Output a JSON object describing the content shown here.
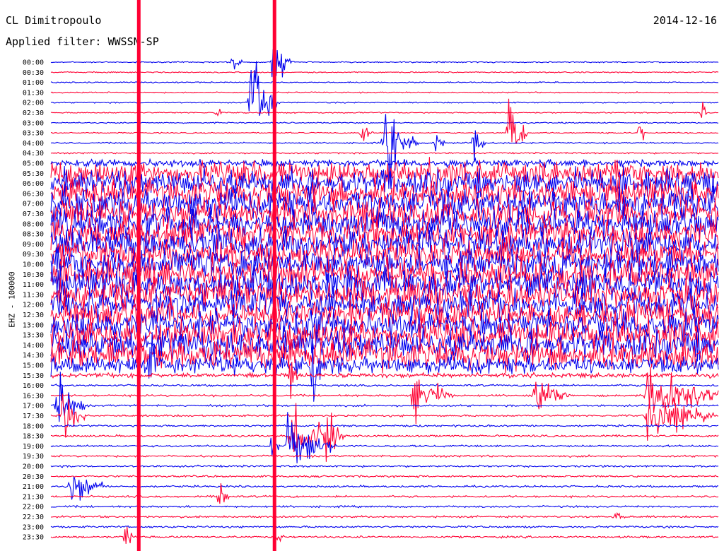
{
  "header": {
    "station": "CL Dimitropoulo",
    "date": "2014-12-16",
    "filter": "Applied filter: WWSSN-SP"
  },
  "colors": {
    "blue": "#0000ee",
    "red": "#ff0033"
  },
  "chart_data": {
    "type": "line",
    "title": "CL Dimitropoulo",
    "ylabel": "EHZ - 100000",
    "y_ticks": [
      "00:00",
      "00:30",
      "01:00",
      "01:30",
      "02:00",
      "02:30",
      "03:00",
      "03:30",
      "04:00",
      "04:30",
      "05:00",
      "05:30",
      "06:00",
      "06:30",
      "07:00",
      "07:30",
      "08:00",
      "08:30",
      "09:00",
      "09:30",
      "10:00",
      "10:30",
      "11:00",
      "11:30",
      "12:00",
      "12:30",
      "13:00",
      "13:30",
      "14:00",
      "14:30",
      "15:00",
      "15:30",
      "16:00",
      "16:30",
      "17:00",
      "17:30",
      "18:00",
      "18:30",
      "19:00",
      "19:30",
      "20:00",
      "20:30",
      "21:00",
      "21:30",
      "22:00",
      "22:30",
      "23:00",
      "23:30"
    ],
    "trace_colors": "alternating blue / red per 30-minute line",
    "noise_level": [
      0.05,
      0.05,
      0.05,
      0.05,
      0.05,
      0.05,
      0.05,
      0.05,
      0.06,
      0.06,
      0.25,
      0.8,
      0.9,
      0.95,
      1.0,
      1.0,
      1.0,
      1.0,
      1.0,
      1.0,
      1.0,
      1.0,
      1.0,
      1.0,
      1.0,
      1.0,
      1.0,
      1.0,
      1.0,
      1.0,
      0.6,
      0.15,
      0.08,
      0.08,
      0.08,
      0.08,
      0.08,
      0.08,
      0.08,
      0.08,
      0.08,
      0.08,
      0.08,
      0.08,
      0.08,
      0.08,
      0.08,
      0.08
    ],
    "events": [
      {
        "row": 0,
        "minute": 8.2,
        "amp": 0.5,
        "width": 0.4
      },
      {
        "row": 0,
        "minute": 10.0,
        "amp": 1.3,
        "width": 0.5
      },
      {
        "row": 0,
        "minute": 10.4,
        "amp": 0.6,
        "width": 0.6
      },
      {
        "row": 4,
        "minute": 9.0,
        "amp": 3.5,
        "width": 0.6
      },
      {
        "row": 4,
        "minute": 9.3,
        "amp": 2.0,
        "width": 1.0
      },
      {
        "row": 5,
        "minute": 7.5,
        "amp": 0.5,
        "width": 0.2
      },
      {
        "row": 5,
        "minute": 29.3,
        "amp": 0.6,
        "width": 0.2
      },
      {
        "row": 7,
        "minute": 14.0,
        "amp": 0.8,
        "width": 0.5
      },
      {
        "row": 7,
        "minute": 20.6,
        "amp": 2.5,
        "width": 0.8
      },
      {
        "row": 7,
        "minute": 26.5,
        "amp": 0.7,
        "width": 0.3
      },
      {
        "row": 8,
        "minute": 15.0,
        "amp": 2.5,
        "width": 0.7
      },
      {
        "row": 8,
        "minute": 15.3,
        "amp": 1.5,
        "width": 1.2
      },
      {
        "row": 8,
        "minute": 17.3,
        "amp": 0.9,
        "width": 0.4
      },
      {
        "row": 8,
        "minute": 19.0,
        "amp": 1.2,
        "width": 0.5
      },
      {
        "row": 30,
        "minute": 4.5,
        "amp": 2.5,
        "width": 0.3
      },
      {
        "row": 30,
        "minute": 11.8,
        "amp": 3.0,
        "width": 0.3
      },
      {
        "row": 31,
        "minute": 10.8,
        "amp": 1.5,
        "width": 0.3
      },
      {
        "row": 33,
        "minute": 16.3,
        "amp": 1.6,
        "width": 1.8
      },
      {
        "row": 33,
        "minute": 21.8,
        "amp": 1.2,
        "width": 1.6
      },
      {
        "row": 33,
        "minute": 26.8,
        "amp": 1.5,
        "width": 4.0
      },
      {
        "row": 34,
        "minute": 0.3,
        "amp": 1.6,
        "width": 1.2
      },
      {
        "row": 35,
        "minute": 0.5,
        "amp": 1.6,
        "width": 1.0
      },
      {
        "row": 35,
        "minute": 26.8,
        "amp": 1.5,
        "width": 3.0
      },
      {
        "row": 37,
        "minute": 10.8,
        "amp": 2.0,
        "width": 2.0
      },
      {
        "row": 37,
        "minute": 12.4,
        "amp": 1.5,
        "width": 0.8
      },
      {
        "row": 38,
        "minute": 10.6,
        "amp": 1.8,
        "width": 2.2
      },
      {
        "row": 38,
        "minute": 10.0,
        "amp": 1.2,
        "width": 0.3
      },
      {
        "row": 42,
        "minute": 0.9,
        "amp": 1.2,
        "width": 1.5
      },
      {
        "row": 43,
        "minute": 7.6,
        "amp": 1.2,
        "width": 0.4
      },
      {
        "row": 45,
        "minute": 25.4,
        "amp": 0.3,
        "width": 0.5
      },
      {
        "row": 47,
        "minute": 3.4,
        "amp": 1.0,
        "width": 0.3
      },
      {
        "row": 47,
        "minute": 10.2,
        "amp": 0.3,
        "width": 0.3
      }
    ],
    "calibration_lines": [
      {
        "minute": 3.95,
        "color": "#ff0033"
      },
      {
        "minute": 10.05,
        "color": "#ff0033"
      }
    ],
    "x_range_minutes": [
      0,
      30
    ],
    "grid": false,
    "legend": "none"
  }
}
